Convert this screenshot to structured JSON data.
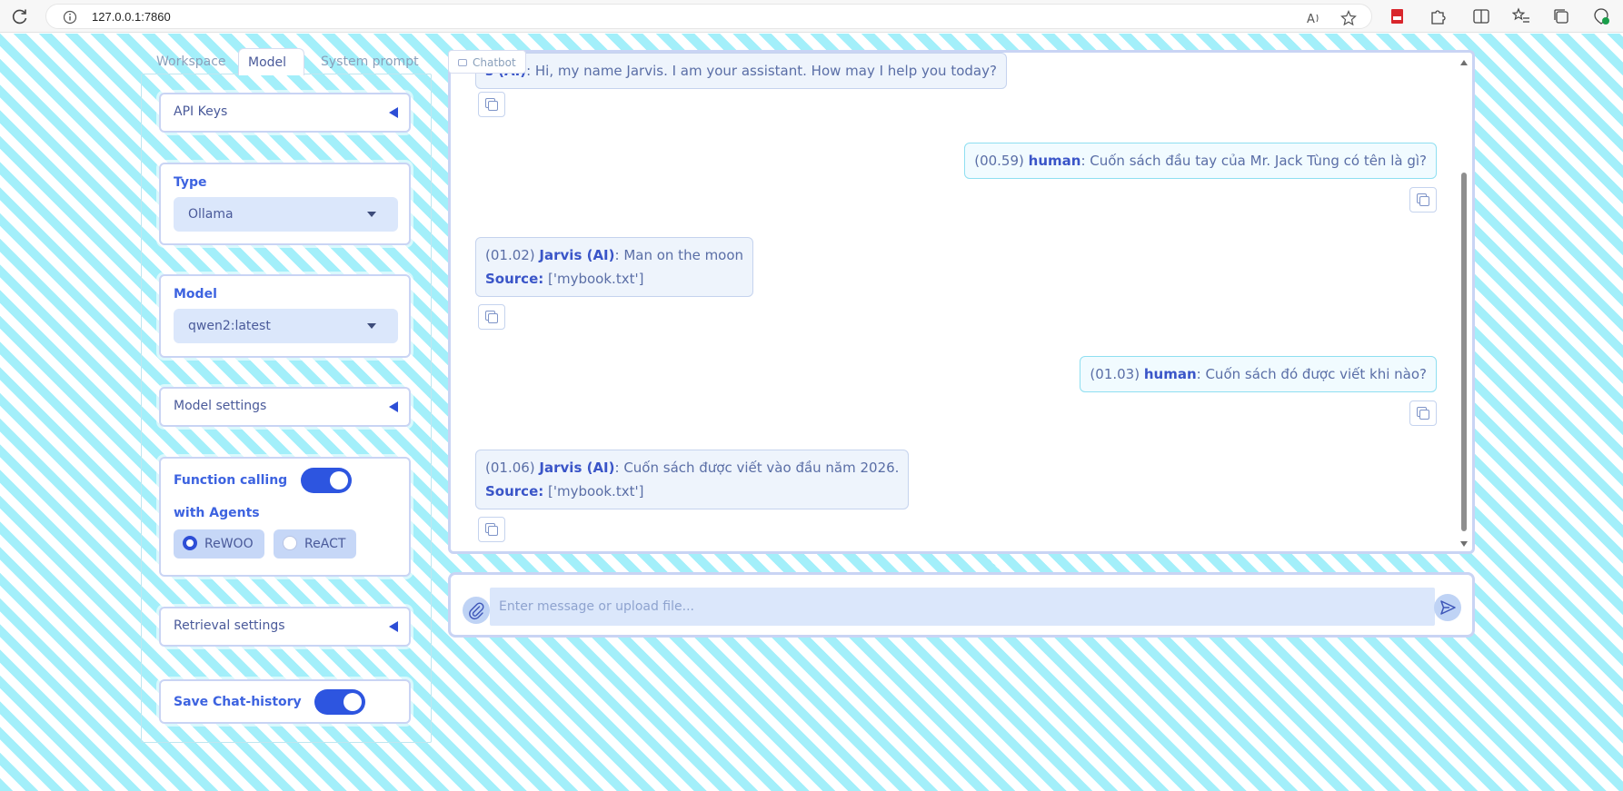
{
  "browser": {
    "url": "127.0.0.1:7860"
  },
  "tabs": [
    {
      "label": "Workspace"
    },
    {
      "label": "Model"
    },
    {
      "label": "System prompt"
    }
  ],
  "sidebar": {
    "api_keys": {
      "label": "API Keys"
    },
    "type": {
      "label": "Type",
      "value": "Ollama"
    },
    "model": {
      "label": "Model",
      "value": "qwen2:latest"
    },
    "model_settings": {
      "label": "Model settings"
    },
    "function_calling": {
      "label": "Function calling",
      "enabled": true
    },
    "agents": {
      "label": "with Agents",
      "options": [
        "ReWOO",
        "ReACT"
      ],
      "selected": "ReWOO"
    },
    "retrieval_settings": {
      "label": "Retrieval settings"
    },
    "save_history": {
      "label": "Save Chat-history",
      "enabled": true
    }
  },
  "chat": {
    "tag": "Chatbot",
    "messages": [
      {
        "role": "ai",
        "time": "",
        "speaker": "s (AI)",
        "text": ": Hi, my name Jarvis. I am your assistant. How may I help you today?",
        "source_label": "",
        "source": ""
      },
      {
        "role": "human",
        "time": "(00.59) ",
        "speaker": "human",
        "text": ": Cuốn sách đầu tay của Mr. Jack Tùng có tên là gì?",
        "source_label": "",
        "source": ""
      },
      {
        "role": "ai",
        "time": "(01.02) ",
        "speaker": "Jarvis (AI)",
        "text": ": Man on the moon",
        "source_label": "Source:",
        "source": " ['mybook.txt']"
      },
      {
        "role": "human",
        "time": "(01.03) ",
        "speaker": "human",
        "text": ": Cuốn sách đó được viết khi nào?",
        "source_label": "",
        "source": ""
      },
      {
        "role": "ai",
        "time": "(01.06) ",
        "speaker": "Jarvis (AI)",
        "text": ": Cuốn sách được viết vào đầu năm 2026.",
        "source_label": "Source:",
        "source": " ['mybook.txt']"
      }
    ]
  },
  "composer": {
    "placeholder": "Enter message or upload file..."
  },
  "colors": {
    "accent": "#2d55e0",
    "stripe": "#a3effa",
    "human_border": "#8fdff1"
  }
}
